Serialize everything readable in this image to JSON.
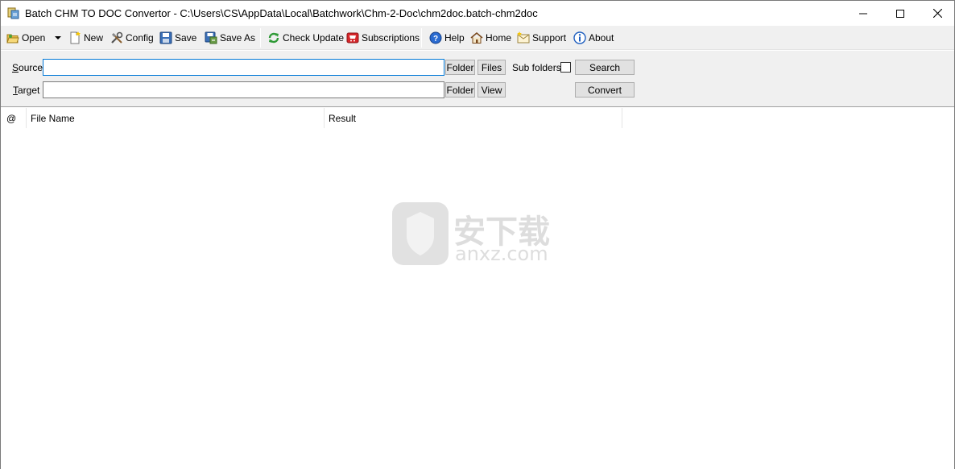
{
  "window": {
    "title": "Batch CHM TO DOC Convertor - C:\\Users\\CS\\AppData\\Local\\Batchwork\\Chm-2-Doc\\chm2doc.batch-chm2doc",
    "icon": "app-icon"
  },
  "toolbar": {
    "items": [
      {
        "label": "Open",
        "icon": "folder-open-icon"
      },
      {
        "label": "",
        "icon": "dropdown-arrow-icon"
      },
      {
        "label": "New",
        "icon": "new-document-icon"
      },
      {
        "label": "Config",
        "icon": "tools-icon"
      },
      {
        "label": "Save",
        "icon": "floppy-disk-icon"
      },
      {
        "label": "Save As",
        "icon": "save-as-icon"
      },
      {
        "label": "Check Update",
        "icon": "refresh-icon"
      },
      {
        "label": "Subscriptions",
        "icon": "cart-icon"
      },
      {
        "label": "Help",
        "icon": "help-icon"
      },
      {
        "label": "Home",
        "icon": "home-icon"
      },
      {
        "label": "Support",
        "icon": "support-icon"
      },
      {
        "label": "About",
        "icon": "info-icon"
      }
    ]
  },
  "form": {
    "source_label": "Source",
    "source_accel": "S",
    "source_rest": "ource",
    "source_value": "",
    "target_label": "Target",
    "target_accel": "T",
    "target_rest": "arget",
    "target_value": "",
    "folder_button": "Folder",
    "files_button": "Files",
    "view_button": "View",
    "subfolders_label": "Sub folders",
    "subfolders_checked": false,
    "search_button": "Search",
    "convert_button": "Convert"
  },
  "list": {
    "columns": [
      "@",
      "File Name",
      "Result"
    ],
    "rows": []
  },
  "watermark": {
    "text_cn": "安下载",
    "text_en": "anxz.com"
  }
}
